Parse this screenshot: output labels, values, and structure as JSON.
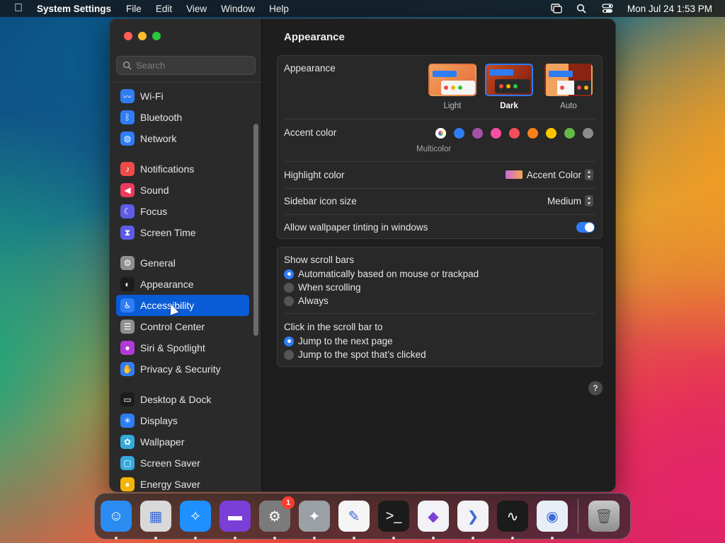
{
  "menubar": {
    "app_name": "System Settings",
    "menus": [
      "File",
      "Edit",
      "View",
      "Window",
      "Help"
    ],
    "datetime": "Mon Jul 24  1:53 PM"
  },
  "sidebar": {
    "search_placeholder": "Search",
    "items": [
      {
        "label": "Wi-Fi",
        "icon": "wifi-icon",
        "color": "#2f7df6"
      },
      {
        "label": "Bluetooth",
        "icon": "bluetooth-icon",
        "color": "#2f7df6"
      },
      {
        "label": "Network",
        "icon": "globe-icon",
        "color": "#2f7df6"
      },
      {
        "label": "Notifications",
        "icon": "bell-icon",
        "color": "#ef4b4b"
      },
      {
        "label": "Sound",
        "icon": "speaker-icon",
        "color": "#ec3a5c"
      },
      {
        "label": "Focus",
        "icon": "moon-icon",
        "color": "#5e5ce6"
      },
      {
        "label": "Screen Time",
        "icon": "hourglass-icon",
        "color": "#5e5ce6"
      },
      {
        "label": "General",
        "icon": "gear-icon",
        "color": "#8e8e93"
      },
      {
        "label": "Appearance",
        "icon": "appearance-icon",
        "color": "#1c1c1e"
      },
      {
        "label": "Accessibility",
        "icon": "accessibility-icon",
        "color": "#2f7df6"
      },
      {
        "label": "Control Center",
        "icon": "control-center-icon",
        "color": "#8e8e93"
      },
      {
        "label": "Siri & Spotlight",
        "icon": "siri-icon",
        "color": "#b03ad6"
      },
      {
        "label": "Privacy & Security",
        "icon": "hand-icon",
        "color": "#2f7df6"
      },
      {
        "label": "Desktop & Dock",
        "icon": "dock-icon",
        "color": "#1c1c1e"
      },
      {
        "label": "Displays",
        "icon": "sun-icon",
        "color": "#2f7df6"
      },
      {
        "label": "Wallpaper",
        "icon": "wallpaper-icon",
        "color": "#34aadc"
      },
      {
        "label": "Screen Saver",
        "icon": "screen-saver-icon",
        "color": "#34aadc"
      },
      {
        "label": "Energy Saver",
        "icon": "bulb-icon",
        "color": "#f4b400"
      }
    ],
    "selected_index": 9
  },
  "main": {
    "title": "Appearance",
    "appearance_label": "Appearance",
    "appearance_options": [
      "Light",
      "Dark",
      "Auto"
    ],
    "appearance_selected": "Dark",
    "accent_label": "Accent color",
    "accent_colors": [
      "#9b59ff",
      "#2f7df6",
      "#a550a7",
      "#f74f9e",
      "#f74e5b",
      "#f7821b",
      "#ffc600",
      "#62ba46",
      "#8c8c8c"
    ],
    "accent_selected_label": "Multicolor",
    "highlight_label": "Highlight color",
    "highlight_value": "Accent Color",
    "icon_size_label": "Sidebar icon size",
    "icon_size_value": "Medium",
    "tinting_label": "Allow wallpaper tinting in windows",
    "tinting_on": true,
    "scrollbars_label": "Show scroll bars",
    "scrollbars_options": [
      "Automatically based on mouse or trackpad",
      "When scrolling",
      "Always"
    ],
    "click_label": "Click in the scroll bar to",
    "click_options": [
      "Jump to the next page",
      "Jump to the spot that’s clicked"
    ],
    "help": "?"
  },
  "dock": {
    "apps": [
      {
        "name": "finder-icon",
        "color": "#2a8cf0"
      },
      {
        "name": "launchpad-icon",
        "color": "#d9d9d9"
      },
      {
        "name": "safari-icon",
        "color": "#1e90ff"
      },
      {
        "name": "simulator-icon",
        "color": "#7a3fd6"
      },
      {
        "name": "system-settings-icon",
        "color": "#7b7b7b",
        "badge": "1"
      },
      {
        "name": "automator-icon",
        "color": "#9aa0a6"
      },
      {
        "name": "textedit-icon",
        "color": "#f5f5f5"
      },
      {
        "name": "terminal-icon",
        "color": "#1b1b1b"
      },
      {
        "name": "visual-studio-icon",
        "color": "#f2f2f7"
      },
      {
        "name": "vscode-icon",
        "color": "#f2f2f7"
      },
      {
        "name": "activity-monitor-icon",
        "color": "#1b1b1b"
      },
      {
        "name": "chromium-icon",
        "color": "#e8eef8"
      }
    ],
    "trash": "trash-icon"
  }
}
